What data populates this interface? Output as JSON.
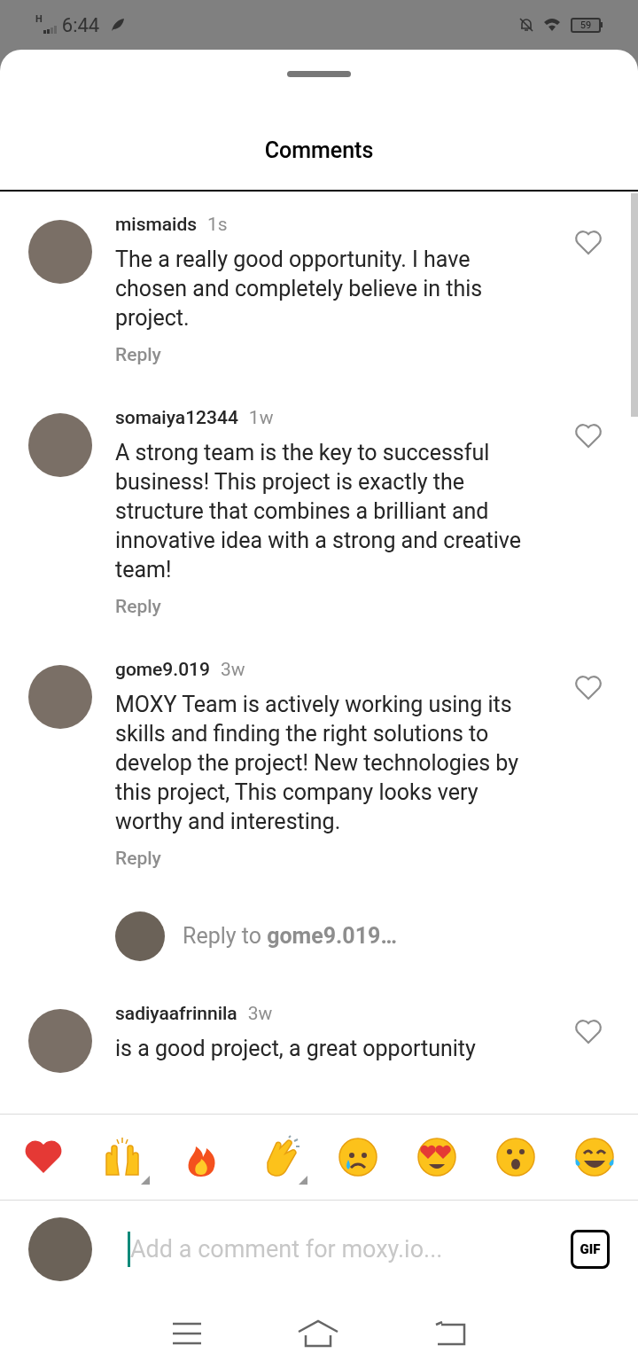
{
  "status_bar": {
    "network": "H",
    "time": "6:44",
    "battery": "59"
  },
  "sheet": {
    "title": "Comments"
  },
  "comments": [
    {
      "username": "mismaids",
      "time": "1s",
      "text": "The a really good opportunity. I have chosen and completely believe in this project.",
      "reply_label": "Reply",
      "liked": false
    },
    {
      "username": "somaiya12344",
      "time": "1w",
      "text": "A strong team is the key to successful business! This project is exactly the structure that combines a brilliant and innovative idea with a strong and creative team!",
      "reply_label": "Reply",
      "liked": false
    },
    {
      "username": "gome9.019",
      "time": "3w",
      "text": "MOXY Team is actively working using its skills and finding the right solutions to develop the project! New technologies by this project, This company looks very worthy and interesting.",
      "reply_label": "Reply",
      "liked": false,
      "reply_prompt": "Reply to **gome9.019…**"
    },
    {
      "username": "sadiyaafrinnila",
      "time": "3w",
      "text": "is a good project, a great opportunity",
      "liked": false
    }
  ],
  "reactions": [
    {
      "kind": "heart",
      "variants": false
    },
    {
      "kind": "raised-hands",
      "variants": true
    },
    {
      "kind": "fire",
      "variants": false
    },
    {
      "kind": "clap",
      "variants": true
    },
    {
      "kind": "crying",
      "variants": false
    },
    {
      "kind": "heart-eyes",
      "variants": false
    },
    {
      "kind": "surprised",
      "variants": false
    },
    {
      "kind": "laughing",
      "variants": false
    }
  ],
  "composer": {
    "placeholder": "Add a comment for moxy.io...",
    "gif_label": "GIF"
  }
}
